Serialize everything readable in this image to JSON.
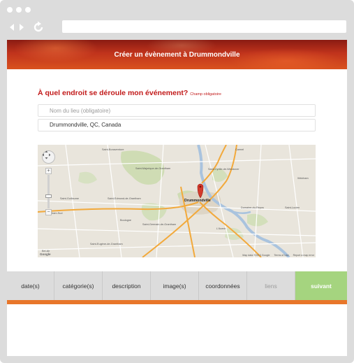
{
  "browser": {
    "dots": [
      "dot",
      "dot",
      "dot"
    ],
    "back_icon": "back-arrow-icon",
    "forward_icon": "forward-arrow-icon",
    "reload_icon": "reload-icon",
    "address": ""
  },
  "header": {
    "title": "Créer un évènement à Drummondville",
    "colors": {
      "dark": "#8a1b12",
      "light": "#d9521f"
    }
  },
  "location_form": {
    "question": "À quel endroit se déroule mon événement?",
    "required_note": "Champ obligatoire",
    "venue_placeholder": "Nom du lieu (obligatoire)",
    "venue_value": "",
    "address_value": "Drummondville, QC, Canada"
  },
  "map": {
    "marker_city": "Drummondville",
    "places": [
      "Saint-Bonaventure",
      "Saint-Majorique-de-Grantham",
      "Saint-Cyrille-de-Wendover",
      "Carmel",
      "Saint-Guillaume",
      "Saint-Edmond-de-Grantham",
      "Durham-Sud",
      "Wickham",
      "Boulogne",
      "Saint-Germain-de-Grantham",
      "Saint-Eugène-de-Grantham",
      "Domaine-du-Repos",
      "Saint-Lucien",
      "L'Avenir",
      "Bel-Air"
    ],
    "road_shields": [
      "224",
      "122",
      "143",
      "139",
      "255",
      "20",
      "55",
      "239",
      "259"
    ],
    "attribution": "Map data ©2013 Google",
    "terms": "Terms of Use",
    "report": "Report a map error",
    "logo": "Google",
    "zoom_in": "+",
    "zoom_out": "−"
  },
  "tabs": [
    {
      "label": "date(s)",
      "state": "default"
    },
    {
      "label": "catégorie(s)",
      "state": "default"
    },
    {
      "label": "description",
      "state": "default"
    },
    {
      "label": "image(s)",
      "state": "default"
    },
    {
      "label": "coordonnées",
      "state": "default"
    },
    {
      "label": "liens",
      "state": "disabled"
    }
  ],
  "next_button": {
    "label": "suivant",
    "color": "#a5d47f"
  },
  "accent_color": "#e8762a"
}
